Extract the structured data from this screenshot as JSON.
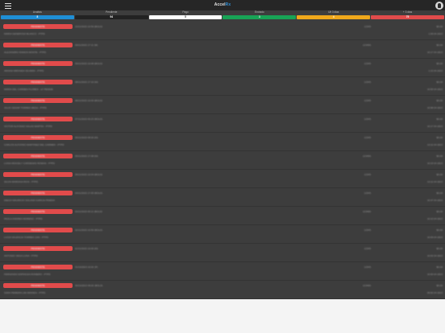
{
  "app": {
    "logo_part1": "Accel",
    "logo_part2": "Rx"
  },
  "tabs": [
    {
      "label": "Analisis",
      "count": "8",
      "color": "#1f8fd6",
      "text_color": "#ffffff"
    },
    {
      "label": "Pendiente",
      "count": "94",
      "color": "#222222",
      "text_color": "#ffffff"
    },
    {
      "label": "Pago",
      "count": "5",
      "color": "#ffffff",
      "text_color": "#333333"
    },
    {
      "label": "Enviado",
      "count": "3",
      "color": "#18a456",
      "text_color": "#ffffff"
    },
    {
      "label": "Ult 3 dias",
      "count": "4",
      "color": "#f0a81b",
      "text_color": "#ffffff"
    },
    {
      "label": "+ 3 dias",
      "count": "75",
      "color": "#e14b4b",
      "text_color": "#ffffff"
    }
  ],
  "rows": [
    {
      "status": "PENDIENTE",
      "date": "10/11/2023 10:59 (BOLD)",
      "subtitle": "MARIA GENEROSA BLANCO - PTPD",
      "num": "12345",
      "right1": "$0.00",
      "right2": "1:59 04 2023"
    },
    {
      "status": "PENDIENTE",
      "date": "09/11/2023 17:11 (M)",
      "subtitle": "ALEJANDRO RAMOS MONTE - PTPD",
      "num": "123456",
      "right1": "$0.00",
      "right2": "10:17 04 2023"
    },
    {
      "status": "PENDIENTE",
      "date": "09/11/2023 10:08 (BOLD)",
      "subtitle": "ARIANA MIRANDA SILVERA - PTPD",
      "num": "12345",
      "right1": "$0.00",
      "right2": "1:10 04 2023"
    },
    {
      "status": "PENDIENTE",
      "date": "08/11/2023 17:10 (M)",
      "subtitle": "MARIA DEL CARMEN FLORES - LF PENDIE",
      "num": "12345",
      "right1": "$0.00",
      "right2": "10:55 04 2023"
    },
    {
      "status": "PENDIENTE",
      "date": "08/11/2023 10:00 (BOLD)",
      "subtitle": "JULIO CESAR TORRES MESA - PTPD",
      "num": "12345",
      "right1": "$0.00",
      "right2": "10:58 04 2023"
    },
    {
      "status": "PENDIENTE",
      "date": "07/11/2023 09:23 (BOLD)",
      "subtitle": "VICTOR ALFONSO SALAS MARTIN - PTPD",
      "num": "12345",
      "right1": "$0.00",
      "right2": "10:17 04 2023"
    },
    {
      "status": "PENDIENTE",
      "date": "06/11/2023 08:00 (M)",
      "subtitle": "CARLOS ALFONSO MARTINEZ DEL CARMEN - PTPD",
      "num": "12345",
      "right1": "$0.00",
      "right2": "10:11 04 2023"
    },
    {
      "status": "PENDIENTE",
      "date": "05/11/2023 17:08 (M)",
      "subtitle": "LUISA ARACELY CARDENAS ROMAN - PTPD",
      "num": "123456",
      "right1": "$0.00",
      "right2": "10:15 04 2023"
    },
    {
      "status": "PENDIENTE",
      "date": "05/11/2023 10:04 (BOLD)",
      "subtitle": "SILVIA MARIANA RIOS - PTPD",
      "num": "12345",
      "right1": "$0.00",
      "right2": "10:11 04 2023"
    },
    {
      "status": "PENDIENTE",
      "date": "04/11/2023 17:05 (BOLD)",
      "subtitle": "DIEGO MAURICIO SOLANO GARCIA PINEDA",
      "num": "12345",
      "right1": "$0.00",
      "right2": "10:47 04 2023"
    },
    {
      "status": "PENDIENTE",
      "date": "03/11/2023 09:11 (BOLD)",
      "subtitle": "PAOLA ANDREA MORENO - PTPD",
      "num": "123456",
      "right1": "$0.00",
      "right2": "10:10 04 2023"
    },
    {
      "status": "PENDIENTE",
      "date": "02/11/2023 10:59 (BOLD)",
      "subtitle": "LUCIA VALENCIA TORRES CAN - PTPD",
      "num": "12345",
      "right1": "$0.00",
      "right2": "10:09 04 2023"
    },
    {
      "status": "PENDIENTE",
      "date": "01/11/2023 10:00 (M)",
      "subtitle": "ANTONIO VEGA LUNA - PTPD",
      "num": "12345",
      "right1": "$0.00",
      "right2": "10:03 04 2023"
    },
    {
      "status": "PENDIENTE",
      "date": "31/10/2023 10:02 (P)",
      "subtitle": "FERNANDO ESPINOZA ROMERO - PTPD",
      "num": "12345",
      "right1": "$0.00",
      "right2": "10:00 04 2023"
    },
    {
      "status": "PENDIENTE",
      "date": "30/10/2023 09:00 (BOLD)",
      "subtitle": "SARA PEREIRA LIM ARANDA - PTPD",
      "num": "123456",
      "right1": "$0.00",
      "right2": "09:50 04 2023"
    }
  ]
}
